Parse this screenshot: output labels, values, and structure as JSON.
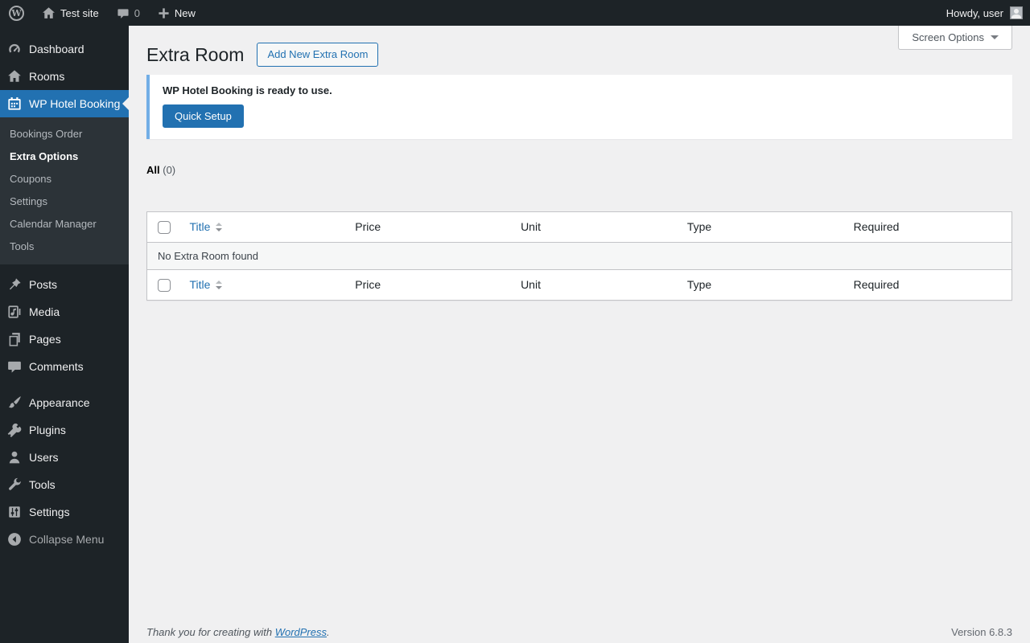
{
  "admin_bar": {
    "site_name": "Test site",
    "comment_count": "0",
    "new_label": "New",
    "howdy_text": "Howdy, user"
  },
  "sidebar": {
    "menu": [
      {
        "label": "Dashboard",
        "icon": "dashboard-icon"
      },
      {
        "label": "Rooms",
        "icon": "home-icon"
      },
      {
        "label": "WP Hotel Booking",
        "icon": "calendar-icon",
        "active": true
      },
      {
        "label": "Posts",
        "icon": "pushpin-icon"
      },
      {
        "label": "Media",
        "icon": "media-icon"
      },
      {
        "label": "Pages",
        "icon": "pages-icon"
      },
      {
        "label": "Comments",
        "icon": "comment-icon"
      },
      {
        "label": "Appearance",
        "icon": "brush-icon"
      },
      {
        "label": "Plugins",
        "icon": "plugin-icon"
      },
      {
        "label": "Users",
        "icon": "user-icon"
      },
      {
        "label": "Tools",
        "icon": "wrench-icon"
      },
      {
        "label": "Settings",
        "icon": "sliders-icon"
      }
    ],
    "submenu": {
      "parent": "WP Hotel Booking",
      "items": [
        {
          "label": "Bookings Order"
        },
        {
          "label": "Extra Options",
          "active": true
        },
        {
          "label": "Coupons"
        },
        {
          "label": "Settings"
        },
        {
          "label": "Calendar Manager"
        },
        {
          "label": "Tools"
        }
      ]
    },
    "collapse_label": "Collapse Menu"
  },
  "main": {
    "page_title": "Extra Room",
    "add_new_button": "Add New Extra Room",
    "screen_options_label": "Screen Options",
    "notice": {
      "message": "WP Hotel Booking is ready to use.",
      "button_label": "Quick Setup"
    },
    "filters": {
      "all_label": "All",
      "all_count": "(0)"
    },
    "table": {
      "columns": [
        "Title",
        "Price",
        "Unit",
        "Type",
        "Required"
      ],
      "sortable_column": "Title",
      "empty_message": "No Extra Room found"
    }
  },
  "footer": {
    "thanks_text": "Thank you for creating with",
    "link_text": "WordPress",
    "period": ".",
    "version": "Version 6.8.3"
  },
  "colors": {
    "adminbar_bg": "#1d2327",
    "menu_bg": "#1d2327",
    "submenu_bg": "#2c3338",
    "highlight_blue": "#2271b1",
    "notice_accent_blue": "#72aee6",
    "content_bg": "#f0f0f1",
    "link_blue": "#2271b1",
    "table_border": "#c3c4c7",
    "icon_gray": "#a7aaad"
  }
}
